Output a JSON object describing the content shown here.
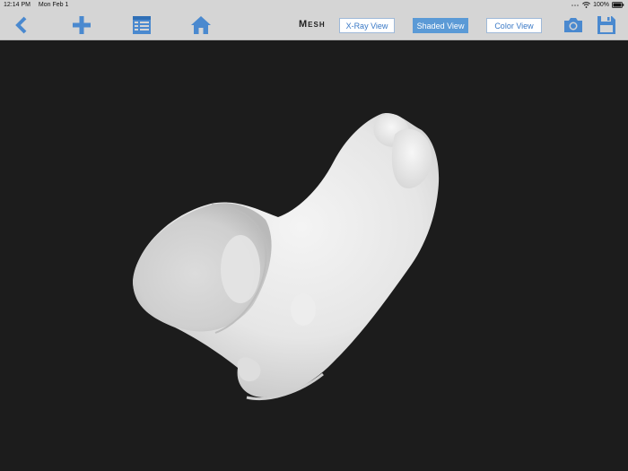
{
  "status": {
    "time": "12:14 PM",
    "date": "Mon Feb 1",
    "battery": "100%",
    "icons": [
      "wifi-icon",
      "battery-icon"
    ]
  },
  "toolbar": {
    "icons": [
      "back-chevron-icon",
      "add-plus-icon",
      "table-list-icon",
      "home-icon",
      "camera-icon",
      "save-floppy-icon"
    ],
    "mode_label": "Mesh",
    "views": {
      "xray": "X-Ray View",
      "shaded": "Shaded View",
      "color": "Color View",
      "active": "shaded"
    }
  },
  "colors": {
    "bar": "#d5d5d5",
    "accent": "#4a89cf",
    "active_button": "#5b9ad6",
    "viewport": "#1c1c1c",
    "mesh": "#e8e8e8"
  }
}
